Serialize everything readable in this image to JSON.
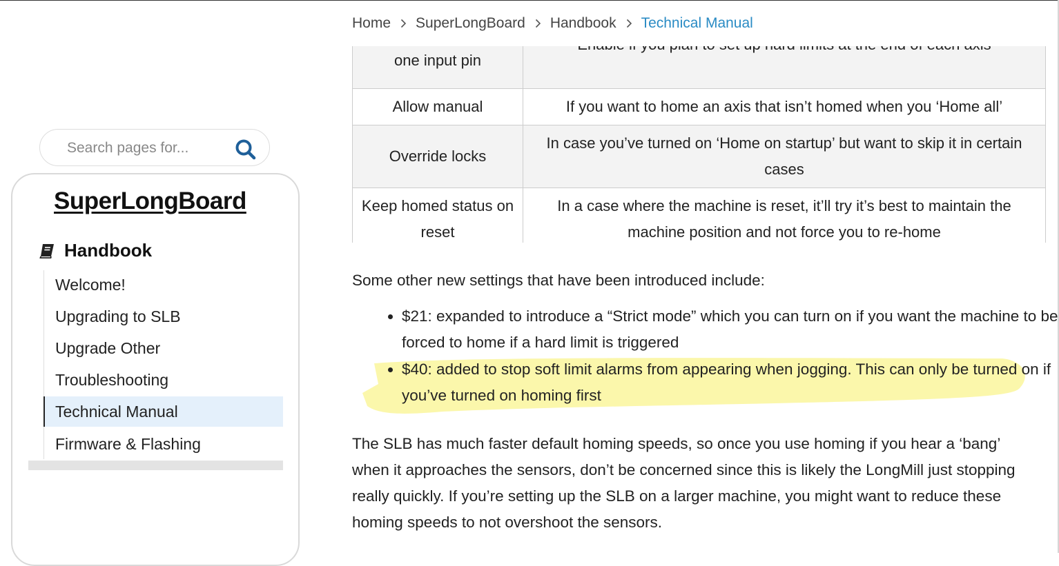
{
  "breadcrumb": {
    "items": [
      "Home",
      "SuperLongBoard",
      "Handbook"
    ],
    "current": "Technical Manual"
  },
  "search": {
    "placeholder": "Search pages for..."
  },
  "sidebar": {
    "title": "SuperLongBoard",
    "section": "Handbook",
    "items": [
      {
        "label": "Welcome!"
      },
      {
        "label": "Upgrading to SLB"
      },
      {
        "label": "Upgrade Other"
      },
      {
        "label": "Troubleshooting"
      },
      {
        "label": "Technical Manual",
        "active": true
      },
      {
        "label": "Firmware & Flashing"
      }
    ]
  },
  "table": {
    "rows": [
      {
        "setting": "one input pin",
        "description": "Enable if you plan to set up hard limits at the end of each axis"
      },
      {
        "setting": "Allow manual",
        "description": "If you want to home an axis that isn’t homed when you ‘Home all’"
      },
      {
        "setting": "Override locks",
        "description": "In case you’ve turned on ‘Home on startup’ but want to skip it in certain cases"
      },
      {
        "setting": "Keep homed status on reset",
        "description": "In a case where the machine is reset, it’ll try it’s best to maintain the machine position and not force you to re-home"
      }
    ]
  },
  "content": {
    "intro": "Some other new settings that have been introduced include:",
    "bullets": [
      "$21: expanded to introduce a “Strict mode” which you can turn on if you want the machine to be forced to home if a hard limit is triggered",
      "$40: added to stop soft limit alarms from appearing when jogging. This can only be turned on if you’ve turned on homing first"
    ],
    "paragraph": "The SLB has much faster default homing speeds, so once you use homing if you hear a ‘bang’ when it approaches the sensors, don’t be concerned since this is likely the LongMill just stopping really quickly. If you’re setting up the SLB on a larger machine, you might want to reduce these homing speeds to not overshoot the sensors."
  },
  "colors": {
    "link": "#2a8bc4",
    "search_icon": "#1e5f99",
    "active_nav_bg": "#e4f0fb",
    "highlight": "#fbf7a6"
  },
  "icons": {
    "search": "search-icon",
    "book": "book-icon",
    "breadcrumb_separator": "chevron-right-icon"
  }
}
